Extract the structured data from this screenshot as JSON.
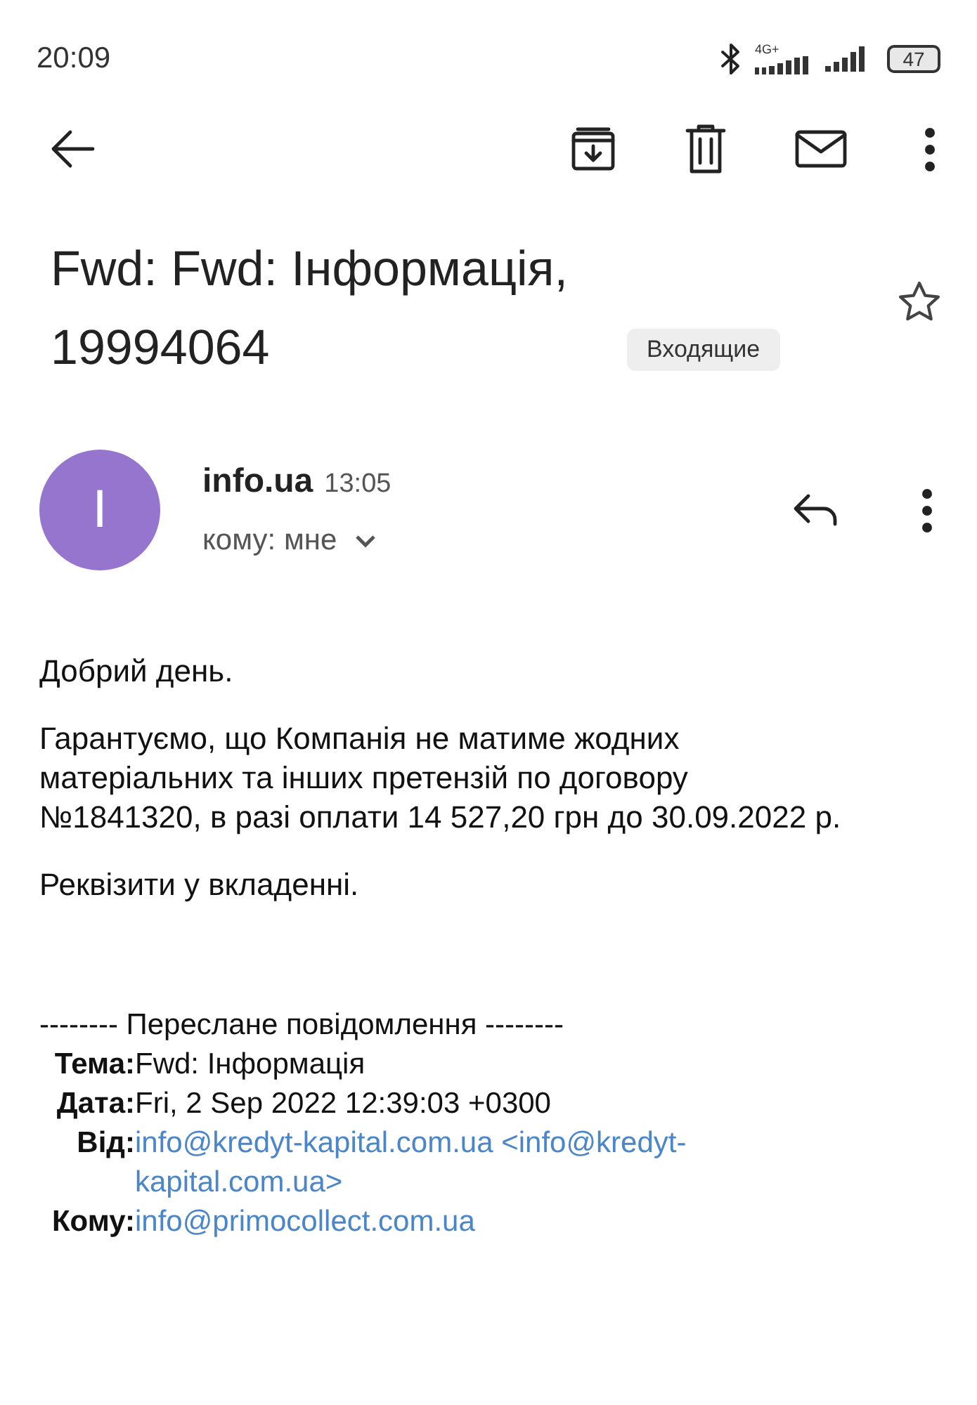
{
  "status_bar": {
    "time": "20:09",
    "network": "4G+",
    "battery": "47"
  },
  "subject": {
    "title": "Fwd: Fwd: Інформація, 19994064",
    "label": "Входящие",
    "starred": false
  },
  "sender": {
    "initial": "I",
    "name": "info.ua",
    "time": "13:05",
    "recipient": "кому: мне",
    "color": "#9575cd"
  },
  "body": [
    "Добрий день.",
    "Гарантуємо, що Компанія не матиме жодних матеріальних та інших претензій по договору №1841320, в разі оплати 14 527,20 грн до 30.09.2022 р.",
    "Реквізити у вкладенні."
  ],
  "forwarded": {
    "header": "-------- Переслане повідомлення --------",
    "fields": [
      {
        "label": "Тема:",
        "value": "Fwd: Інформація",
        "kind": "text"
      },
      {
        "label": "Дата:",
        "value": "Fri, 2 Sep 2022 12:39:03 +0300",
        "kind": "text"
      },
      {
        "label": "Від:",
        "value": "info@kredyt-kapital.com.ua <info@kredyt-kapital.com.ua>",
        "kind": "link"
      },
      {
        "label": "Кому:",
        "value": "info@primocollect.com.ua",
        "kind": "link"
      }
    ]
  }
}
